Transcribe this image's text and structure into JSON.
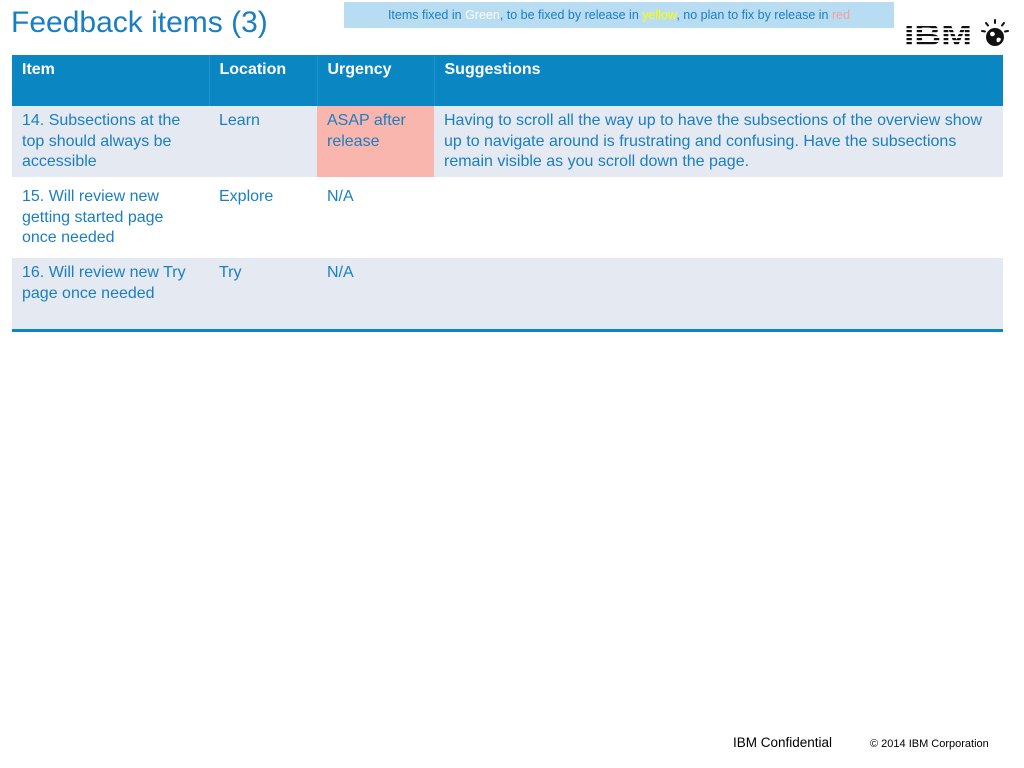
{
  "slide": {
    "title": "Feedback items (3)"
  },
  "legend": {
    "part1": "Items fixed in ",
    "green_word": "Green",
    "part2": ", to be fixed by release in ",
    "yellow_word": "yellow",
    "part3": ", no plan to fix by release in ",
    "red_word": "red"
  },
  "colors": {
    "title": "#1a7fc1",
    "header_bg": "#0a86c2",
    "row_shaded": "#e4e9f2",
    "urgency_red": "#f8b6ae",
    "legend_bg": "#b8dcf2",
    "legend_green": "#ffffff",
    "legend_yellow": "#ffff00",
    "legend_red": "#f4a0a0"
  },
  "logo": {
    "brand": "IBM",
    "icon": "smarter-planet-globe-icon"
  },
  "table": {
    "headers": [
      "Item",
      "Location",
      "Urgency",
      "Suggestions"
    ],
    "rows": [
      {
        "item": "14. Subsections at the top should always be accessible",
        "location": "Learn",
        "urgency": "ASAP after release",
        "suggestions": "Having to scroll all the way up to have the subsections of the overview show up to navigate around is frustrating and confusing. Have the subsections remain visible as you scroll down the page."
      },
      {
        "item": "15. Will review new getting started page once needed",
        "location": "Explore",
        "urgency": "N/A",
        "suggestions": ""
      },
      {
        "item": "16. Will review new Try page once needed",
        "location": "Try",
        "urgency": "N/A",
        "suggestions": ""
      }
    ]
  },
  "footer": {
    "confidential": "IBM Confidential",
    "copyright": "© 2014 IBM Corporation"
  }
}
